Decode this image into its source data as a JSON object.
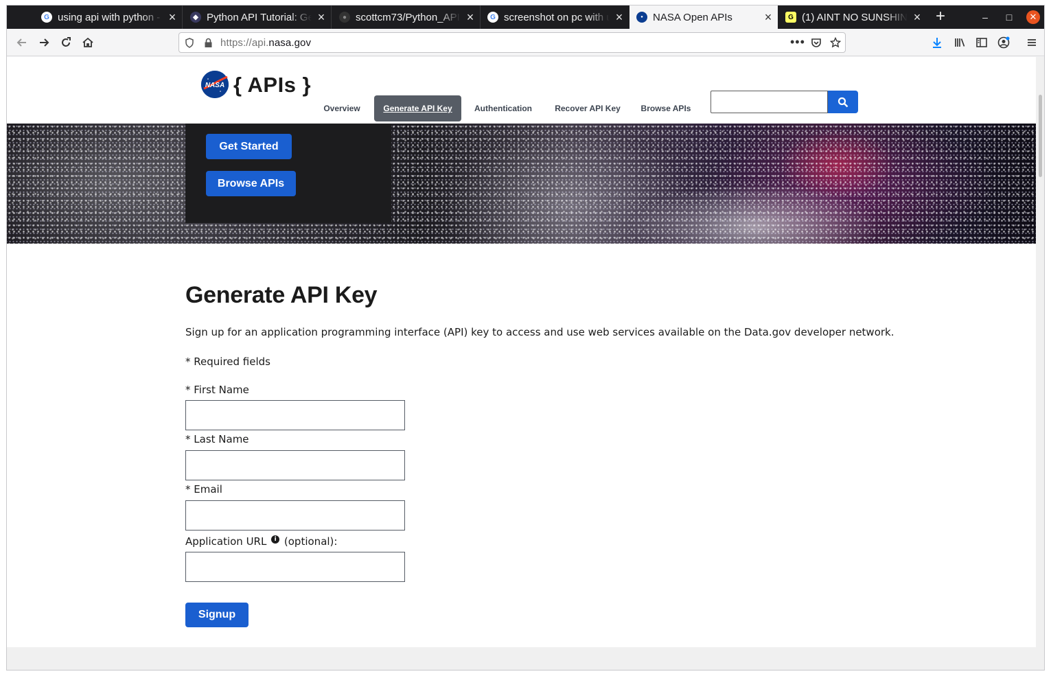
{
  "browser": {
    "tabs": [
      {
        "title": "using api with python -",
        "icon": "google-icon"
      },
      {
        "title": "Python API Tutorial: Ge",
        "icon": "dataquest-icon"
      },
      {
        "title": "scottcm73/Python_API",
        "icon": "github-icon"
      },
      {
        "title": "screenshot on pc with u",
        "icon": "google-icon"
      },
      {
        "title": "NASA Open APIs",
        "icon": "nasa-icon",
        "active": true
      },
      {
        "title": "(1) AINT NO SUNSHINE",
        "icon": "genius-icon"
      }
    ],
    "url_prefix": "https://api.",
    "url_domain": "nasa.gov"
  },
  "header": {
    "logo_text": "{ APIs }",
    "nav": [
      "Overview",
      "Generate API Key",
      "Authentication",
      "Recover API Key",
      "Browse APIs"
    ],
    "active_nav": "Generate API Key",
    "search_value": ""
  },
  "hero": {
    "get_started": "Get Started",
    "browse_apis": "Browse APIs"
  },
  "form": {
    "title": "Generate API Key",
    "intro": "Sign up for an application programming interface (API) key to access and use web services available on the Data.gov developer network.",
    "required_note": "* Required fields",
    "first_name_label": "* First Name",
    "last_name_label": "* Last Name",
    "email_label": "* Email",
    "app_url_label": "Application URL",
    "app_url_suffix": "(optional):",
    "submit": "Signup"
  },
  "colors": {
    "primary_button": "#1a5fd0",
    "active_nav_bg": "#565c65",
    "tab_strip": "#1d1d20",
    "close_button": "#e95420"
  }
}
